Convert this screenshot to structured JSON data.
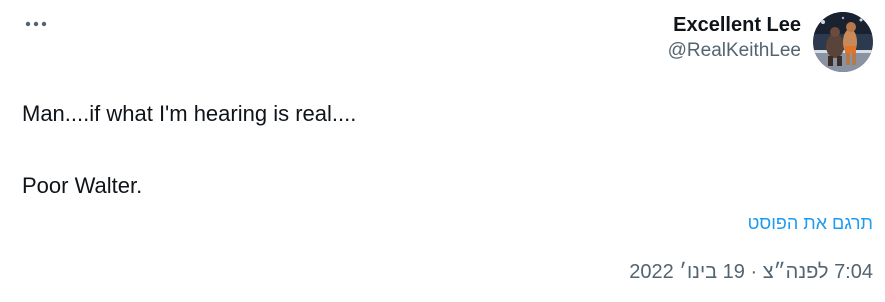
{
  "tweet": {
    "author": {
      "display_name": "Excellent Lee",
      "handle": "@RealKeithLee",
      "avatar_icon": "wrestler-avatar"
    },
    "more_icon": "more-horizontal-icon",
    "text_lines": [
      "Man....if what I'm hearing is real....",
      "Poor Walter."
    ],
    "translate_label": "תרגם את הפוסט",
    "timestamp": "7:04 לפנה״צ · 19 בינו׳ 2022"
  },
  "colors": {
    "text": "#0f1419",
    "muted": "#536471",
    "link": "#1d9bf0"
  }
}
